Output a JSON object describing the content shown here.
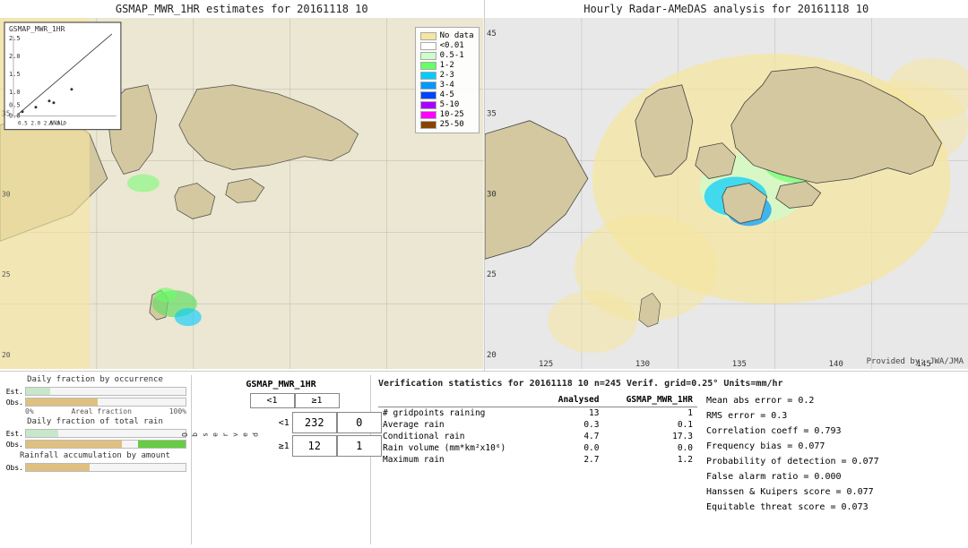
{
  "left_map": {
    "title": "GSMAP_MWR_1HR estimates for 20161118 10"
  },
  "right_map": {
    "title": "Hourly Radar-AMeDAS analysis for 20161118 10",
    "provided_label": "Provided by: JWA/JMA"
  },
  "legend": {
    "title": "No data",
    "items": [
      {
        "label": "No data",
        "color": "#f5e6a0"
      },
      {
        "label": "<0.01",
        "color": "#ffffff"
      },
      {
        "label": "0.5-1",
        "color": "#ccffcc"
      },
      {
        "label": "1-2",
        "color": "#66ff66"
      },
      {
        "label": "2-3",
        "color": "#00ccff"
      },
      {
        "label": "3-4",
        "color": "#0099ff"
      },
      {
        "label": "4-5",
        "color": "#0044ff"
      },
      {
        "label": "5-10",
        "color": "#aa00ff"
      },
      {
        "label": "10-25",
        "color": "#ff00ff"
      },
      {
        "label": "25-50",
        "color": "#884400"
      }
    ]
  },
  "charts": {
    "occurrence_title": "Daily fraction by occurrence",
    "rain_title": "Daily fraction of total rain",
    "accumulation_title": "Rainfall accumulation by amount",
    "est_label": "Est.",
    "obs_label": "Obs.",
    "axis_start": "0%",
    "axis_mid": "Areal fraction",
    "axis_end": "100%"
  },
  "contingency": {
    "title": "GSMAP_MWR_1HR",
    "col_lt1": "<1",
    "col_ge1": "≥1",
    "row_lt1": "<1",
    "row_ge1": "≥1",
    "observed_label": "O\nb\ns\ne\nr\nv\ne\nd",
    "cells": {
      "lt1_lt1": "232",
      "lt1_ge1": "0",
      "ge1_lt1": "12",
      "ge1_ge1": "1"
    }
  },
  "verification": {
    "title": "Verification statistics for 20161118 10  n=245  Verif. grid=0.25°  Units=mm/hr",
    "headers": [
      "",
      "Analysed",
      "GSMAP_MWR_1HR"
    ],
    "rows": [
      {
        "label": "# gridpoints raining",
        "analysed": "13",
        "gsmap": "1"
      },
      {
        "label": "Average rain",
        "analysed": "0.3",
        "gsmap": "0.1"
      },
      {
        "label": "Conditional rain",
        "analysed": "4.7",
        "gsmap": "17.3"
      },
      {
        "label": "Rain volume (mm*km²x10⁶)",
        "analysed": "0.0",
        "gsmap": "0.0"
      },
      {
        "label": "Maximum rain",
        "analysed": "2.7",
        "gsmap": "1.2"
      }
    ]
  },
  "scores": {
    "mean_abs_error": "Mean abs error = 0.2",
    "rms_error": "RMS error = 0.3",
    "correlation_coeff": "Correlation coeff = 0.793",
    "frequency_bias": "Frequency bias = 0.077",
    "prob_detection": "Probability of detection = 0.077",
    "false_alarm_ratio": "False alarm ratio = 0.000",
    "hanssen_kuipers": "Hanssen & Kuipers score = 0.077",
    "equitable_threat": "Equitable threat score = 0.073"
  }
}
